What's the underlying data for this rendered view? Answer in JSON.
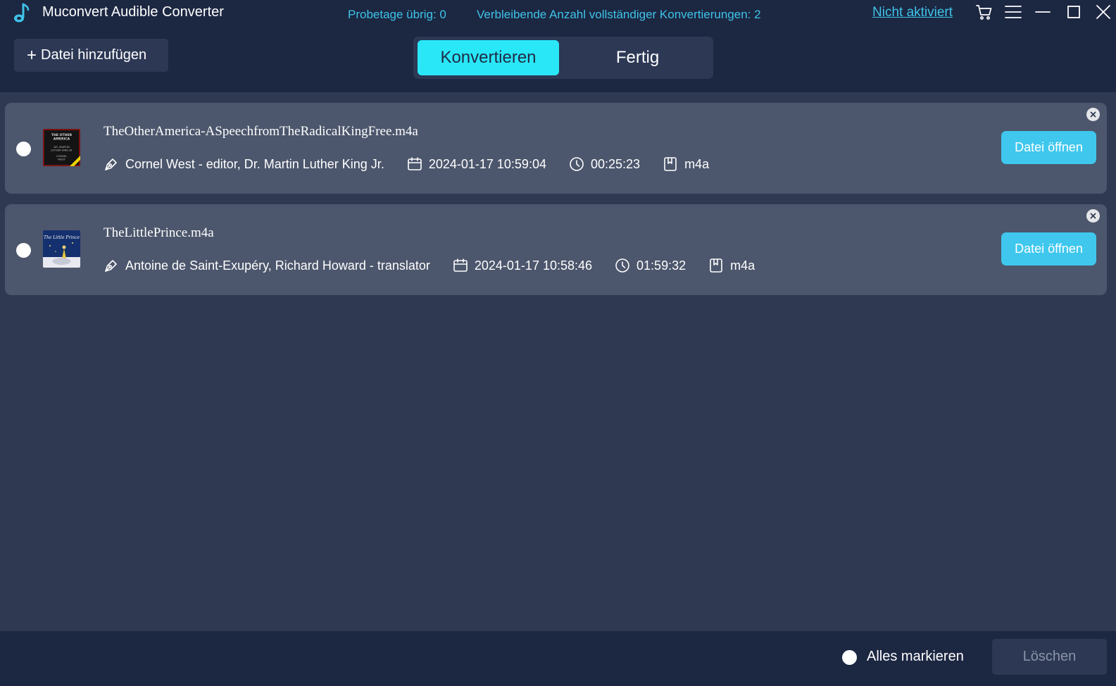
{
  "app": {
    "title": "Muconvert Audible Converter",
    "logo_icon": "music-note-icon"
  },
  "header": {
    "trial_days": "Probetage übrig: 0",
    "remaining_conversions": "Verbleibende Anzahl vollständiger Konvertierungen: 2",
    "activation_link": "Nicht aktiviert",
    "icons": [
      "cart-icon",
      "menu-icon",
      "minimize-icon",
      "maximize-icon",
      "close-icon"
    ]
  },
  "toolbar": {
    "add_file_plus": "+",
    "add_file_label": "Datei hinzufügen"
  },
  "tabs": [
    {
      "label": "Konvertieren",
      "active": true
    },
    {
      "label": "Fertig",
      "active": false
    }
  ],
  "files": [
    {
      "name": "TheOtherAmerica-ASpeechfromTheRadicalKingFree.m4a",
      "author": "Cornel West - editor, Dr. Martin Luther King Jr.",
      "date": "2024-01-17 10:59:04",
      "duration": "00:25:23",
      "format": "m4a",
      "open_label": "Datei öffnen",
      "cover_text": [
        "THE OTHER",
        "AMERICA",
        "DR. MARTIN",
        "LUTHER KING JR.",
        "CORNEL",
        "WEST"
      ]
    },
    {
      "name": "TheLittlePrince.m4a",
      "author": "Antoine de Saint-Exupéry, Richard Howard - translator",
      "date": "2024-01-17 10:58:46",
      "duration": "01:59:32",
      "format": "m4a",
      "open_label": "Datei öffnen",
      "cover_text": [
        "The Little Prince"
      ]
    }
  ],
  "footer": {
    "select_all_label": "Alles markieren",
    "delete_label": "Löschen"
  },
  "colors": {
    "accent": "#2ae7f7",
    "link": "#3ec3e8",
    "button": "#3fc7ee",
    "header_bg": "#1c2742",
    "body_bg": "#2f3a52",
    "card_bg": "#4c566c"
  }
}
